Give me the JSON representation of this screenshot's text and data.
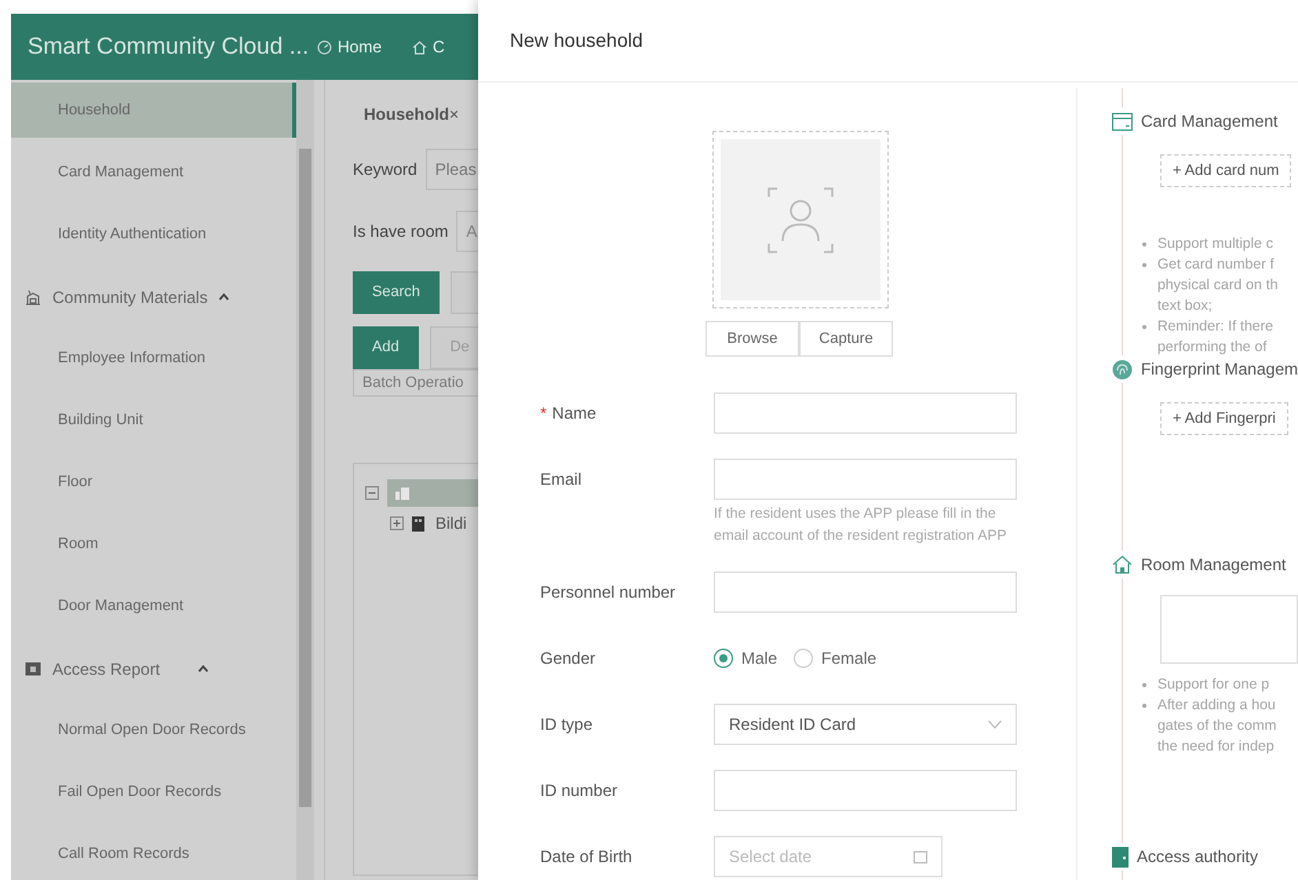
{
  "app": {
    "title": "Smart Community Cloud ...",
    "nav": [
      {
        "label": "Home"
      },
      {
        "label": "C"
      }
    ]
  },
  "sidebar": {
    "items": [
      {
        "label": "Household",
        "kind": "item",
        "selected": true
      },
      {
        "label": "Card Management",
        "kind": "item",
        "selected": false
      },
      {
        "label": "Identity Authentication",
        "kind": "item",
        "selected": false
      },
      {
        "label": "Community Materials",
        "kind": "group",
        "expanded": true
      },
      {
        "label": "Employee Information",
        "kind": "item",
        "selected": false
      },
      {
        "label": "Building Unit",
        "kind": "item",
        "selected": false
      },
      {
        "label": "Floor",
        "kind": "item",
        "selected": false
      },
      {
        "label": "Room",
        "kind": "item",
        "selected": false
      },
      {
        "label": "Door Management",
        "kind": "item",
        "selected": false
      },
      {
        "label": "Access Report",
        "kind": "group",
        "expanded": true
      },
      {
        "label": "Normal Open Door Records",
        "kind": "item",
        "selected": false
      },
      {
        "label": "Fail Open Door Records",
        "kind": "item",
        "selected": false
      },
      {
        "label": "Call Room Records",
        "kind": "item",
        "selected": false
      }
    ]
  },
  "page": {
    "tab": {
      "label": "Household",
      "close": "×"
    },
    "filters": [
      {
        "label": "Keyword",
        "placeholder": "Pleas"
      },
      {
        "label": "Is have room",
        "value": "A"
      }
    ],
    "search_button": "Search",
    "buttons": [
      {
        "label": "Add",
        "kind": "primary"
      },
      {
        "label": "De",
        "kind": "default"
      }
    ],
    "batch": "Batch Operatio",
    "tree": [
      {
        "expanded": true,
        "selected": true,
        "children": [
          {
            "label": "Bildi",
            "expanded": false,
            "selected": false
          }
        ]
      }
    ]
  },
  "drawer": {
    "title": "New household",
    "photo_buttons": [
      "Browse",
      "Capture"
    ],
    "fields": [
      {
        "kind": "text",
        "label": "Name",
        "required_mark": "*"
      },
      {
        "kind": "text",
        "label": "Email",
        "help": "If the resident uses the APP please fill in the email account of the resident registration APP"
      },
      {
        "kind": "text",
        "label": "Personnel number"
      },
      {
        "kind": "radio",
        "label": "Gender",
        "options": [
          {
            "label": "Male",
            "selected": true
          },
          {
            "label": "Female",
            "selected": false
          }
        ]
      },
      {
        "kind": "select",
        "label": "ID type",
        "value": "Resident ID Card"
      },
      {
        "kind": "text",
        "label": "ID number"
      },
      {
        "kind": "date",
        "label": "Date of Birth",
        "placeholder": "Select date"
      }
    ],
    "sections": [
      {
        "kind": "card",
        "title": "Card Management",
        "add_button": "+ Add card num",
        "notes": [
          [
            "Support multiple c"
          ],
          [
            "Get card number f",
            "physical card on th",
            "text box;"
          ],
          [
            "Reminder: If there",
            "performing the of"
          ]
        ]
      },
      {
        "kind": "fingerprint",
        "title": "Fingerprint Managem",
        "add_button": "+ Add Fingerpri"
      },
      {
        "kind": "room",
        "title": "Room Management",
        "notes": [
          [
            "Support for one p"
          ],
          [
            "After adding a hou",
            "gates of the comm",
            "the need for indep"
          ]
        ]
      },
      {
        "kind": "access",
        "title": "Access authority"
      }
    ]
  }
}
